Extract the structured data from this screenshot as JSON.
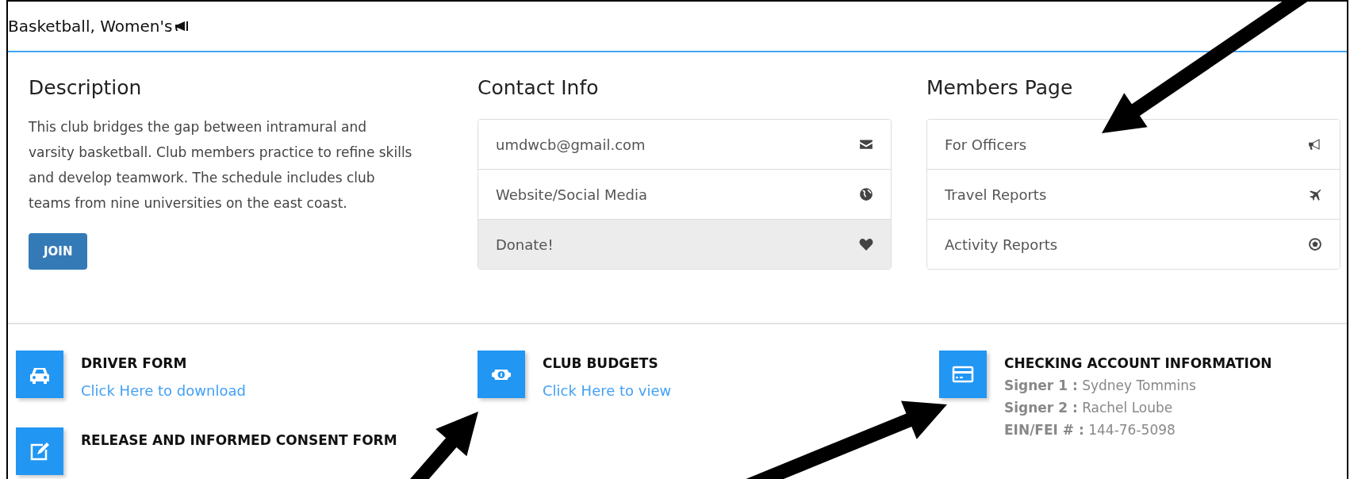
{
  "header": {
    "title": "Basketball, Women's"
  },
  "description": {
    "heading": "Description",
    "text": "This club bridges the gap between intramural and varsity basketball. Club members practice to refine skills and develop teamwork. The schedule includes club teams from nine universities on the east coast.",
    "button": "JOIN"
  },
  "contact": {
    "heading": "Contact Info",
    "items": [
      {
        "label": "umdwcb@gmail.com",
        "active": false
      },
      {
        "label": "Website/Social Media",
        "active": false
      },
      {
        "label": "Donate!",
        "active": true
      }
    ]
  },
  "members": {
    "heading": "Members Page",
    "items": [
      {
        "label": "For Officers",
        "active": false
      },
      {
        "label": "Travel Reports",
        "active": false
      },
      {
        "label": "Activity Reports",
        "active": false
      }
    ]
  },
  "resources": [
    [
      {
        "title": "DRIVER FORM",
        "kind": "link",
        "link": "Click Here to download"
      },
      {
        "title": "RELEASE AND INFORMED CONSENT FORM",
        "kind": "title"
      }
    ],
    [
      {
        "title": "CLUB BUDGETS",
        "kind": "link",
        "link": "Click Here to view"
      }
    ],
    [
      {
        "title": "CHECKING ACCOUNT INFORMATION",
        "kind": "details",
        "details": [
          {
            "label": "Signer 1 :",
            "value": "Sydney Tommins"
          },
          {
            "label": "Signer 2 :",
            "value": "Rachel Loube"
          },
          {
            "label": "EIN/FEI # :",
            "value": "144-76-5098"
          }
        ]
      }
    ]
  ],
  "annotations": [
    {
      "kind": "arrow"
    },
    {
      "kind": "arrow"
    },
    {
      "kind": "arrow"
    }
  ]
}
